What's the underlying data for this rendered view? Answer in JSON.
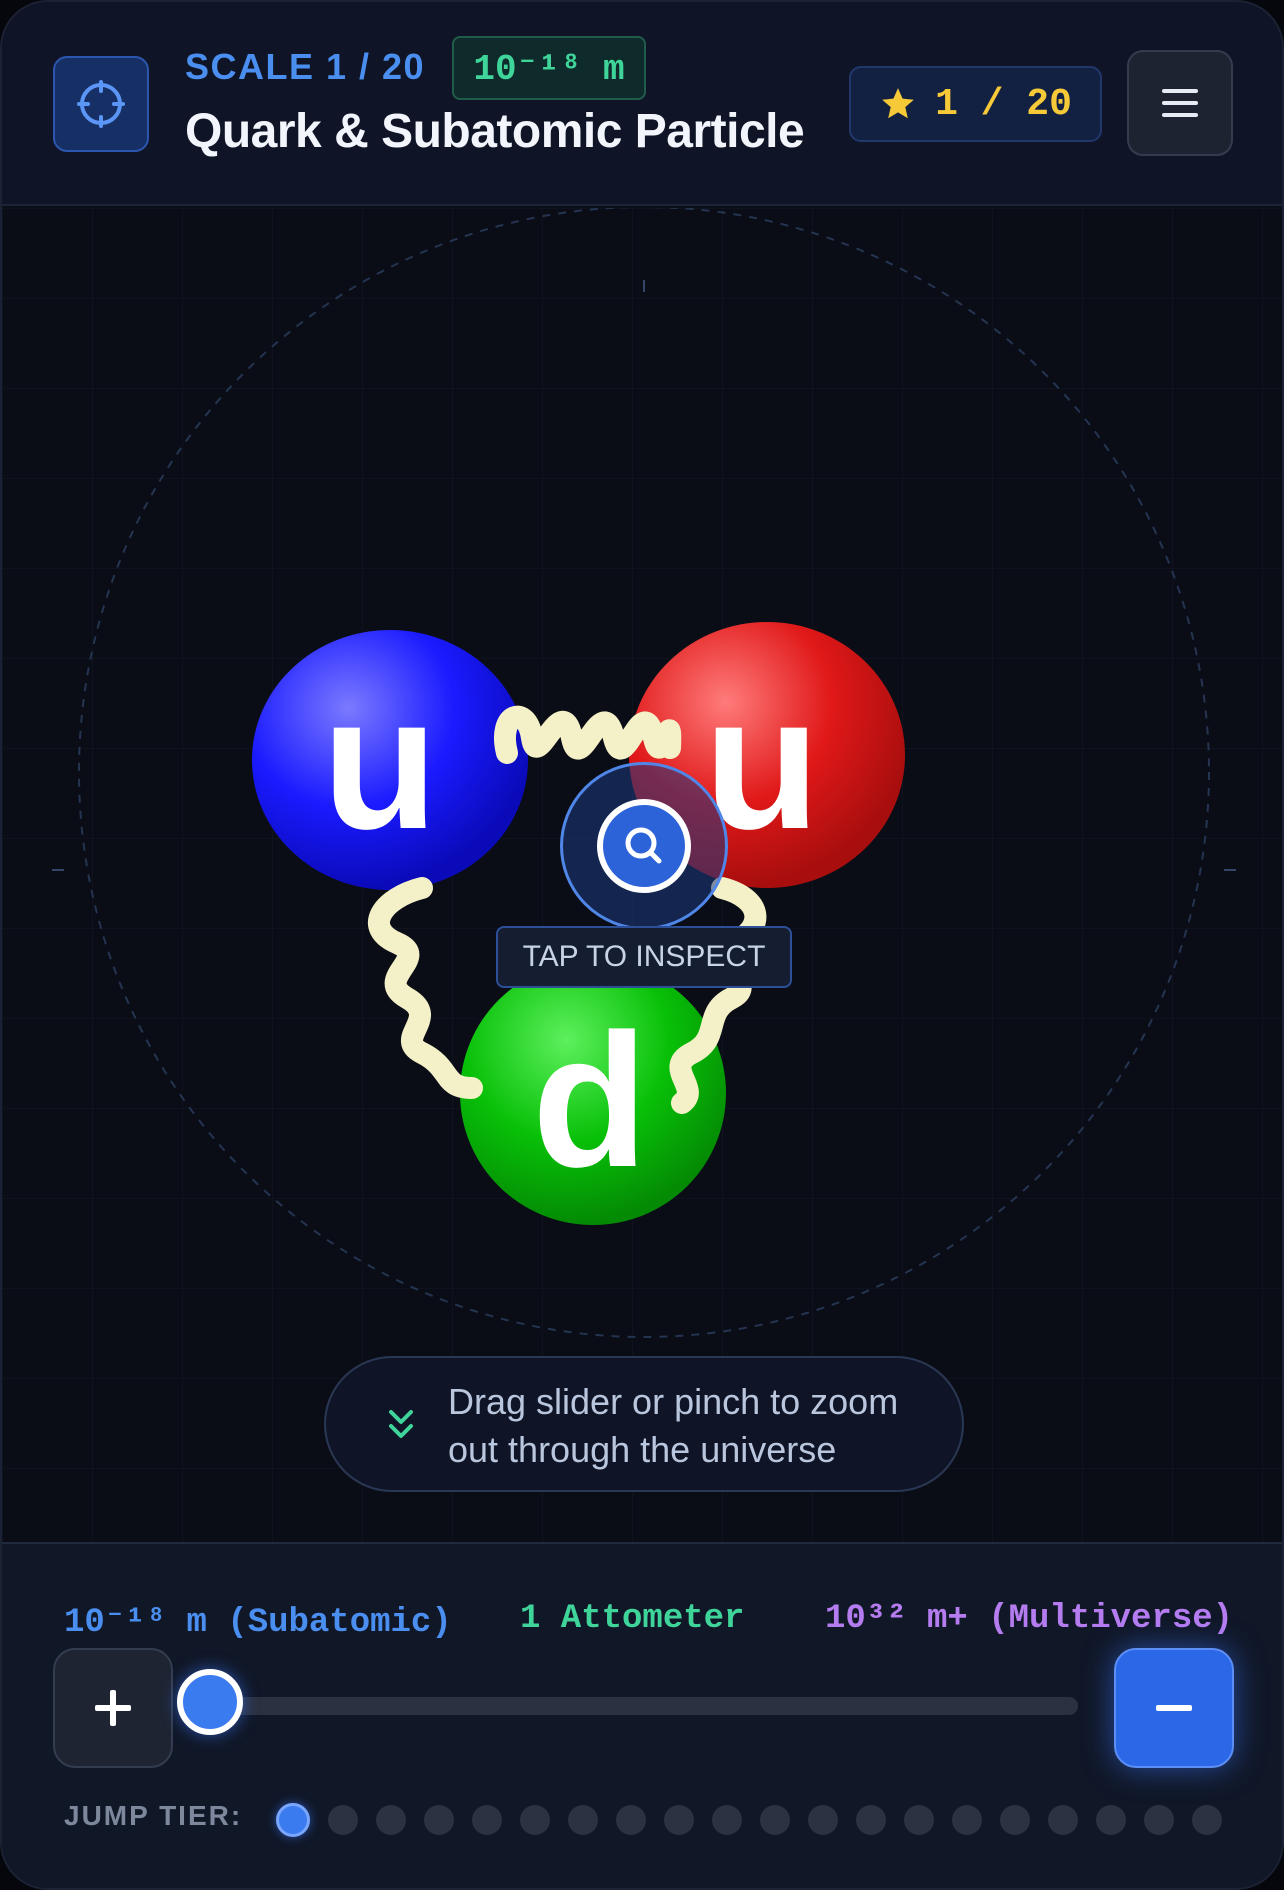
{
  "header": {
    "scale_label": "SCALE 1 / 20",
    "exponent_badge": "10⁻¹⁸ m",
    "title": "Quark & Subatomic Particle",
    "progress": "1 / 20",
    "locate_icon": "crosshair-icon",
    "star_icon": "star-icon",
    "menu_icon": "hamburger-menu-icon"
  },
  "viewport": {
    "quarks": [
      {
        "label": "u",
        "color": "#1a1aff"
      },
      {
        "label": "u",
        "color": "#e01818"
      },
      {
        "label": "d",
        "color": "#08c008"
      }
    ],
    "gluon_color": "#f4f0c8",
    "inspect_label": "TAP TO INSPECT",
    "inspect_icon": "magnifier-icon",
    "hint_text": "Drag slider or pinch to zoom out through the universe",
    "hint_icon": "chevron-double-down-icon"
  },
  "controls": {
    "range_min": "10⁻¹⁸ m (Subatomic)",
    "range_current": "1 Attometer",
    "range_max": "10³² m+ (Multiverse)",
    "zoom_in_label": "+",
    "zoom_out_label": "−",
    "slider_position": 0,
    "jump_label": "JUMP TIER:",
    "tier_count": 20,
    "active_tier": 1
  },
  "colors": {
    "accent_blue": "#3b7bf0",
    "accent_green": "#3fd49a",
    "accent_purple": "#b57cf0",
    "accent_gold": "#f6c938"
  }
}
